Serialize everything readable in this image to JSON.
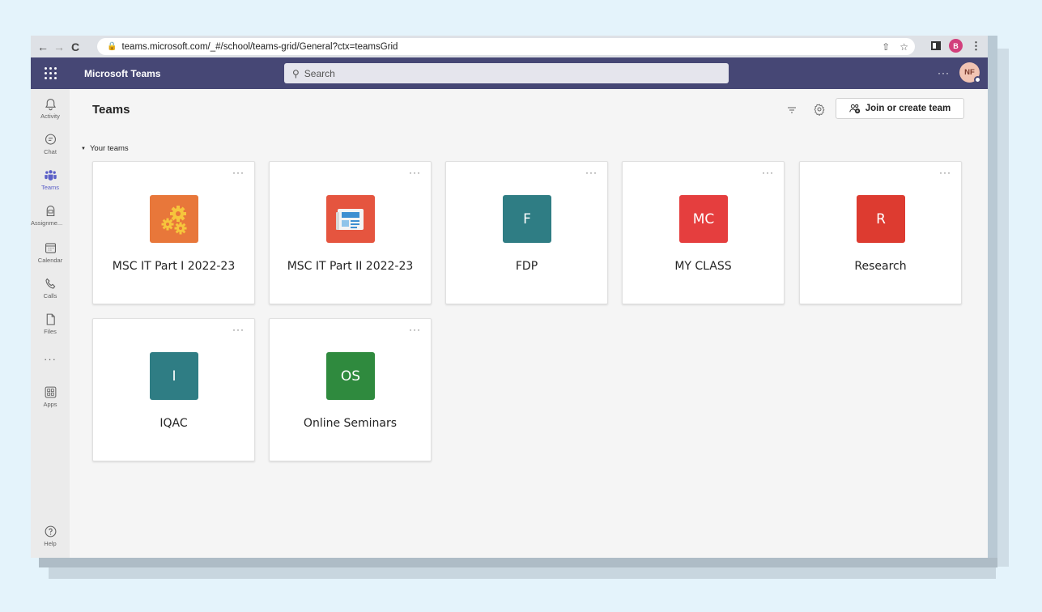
{
  "browser": {
    "url": "teams.microsoft.com/_#/school/teams-grid/General?ctx=teamsGrid",
    "profile_initial": "B",
    "profile_color": "#d23f7c"
  },
  "header": {
    "app_title": "Microsoft Teams",
    "search_placeholder": "Search",
    "more": "···",
    "avatar_initials": "NF",
    "bar_color": "#464775"
  },
  "rail": {
    "items": [
      {
        "label": "Activity",
        "icon": "bell-icon"
      },
      {
        "label": "Chat",
        "icon": "chat-icon"
      },
      {
        "label": "Teams",
        "icon": "teams-icon",
        "active": true
      },
      {
        "label": "Assignme...",
        "icon": "assignments-icon"
      },
      {
        "label": "Calendar",
        "icon": "calendar-icon"
      },
      {
        "label": "Calls",
        "icon": "phone-icon"
      },
      {
        "label": "Files",
        "icon": "file-icon"
      },
      {
        "label": "Apps",
        "icon": "apps-icon"
      },
      {
        "label": "Help",
        "icon": "help-icon"
      }
    ],
    "more": "···"
  },
  "main": {
    "title": "Teams",
    "join_label": "Join or create team",
    "section_label": "Your teams",
    "card_more": "···"
  },
  "teams": [
    {
      "name": "MSC IT Part I 2022-23",
      "icon": "gears-icon",
      "color": "#e8773a"
    },
    {
      "name": "MSC IT Part II 2022-23",
      "icon": "newspaper-icon",
      "color": "#e5553f"
    },
    {
      "name": "FDP",
      "initials": "F",
      "color": "#2f7d84"
    },
    {
      "name": "MY CLASS",
      "initials": "MC",
      "color": "#e53e3e"
    },
    {
      "name": "Research",
      "initials": "R",
      "color": "#dd3b30"
    },
    {
      "name": "IQAC",
      "initials": "I",
      "color": "#2f7d84"
    },
    {
      "name": "Online Seminars",
      "initials": "OS",
      "color": "#2f8a3e"
    }
  ]
}
